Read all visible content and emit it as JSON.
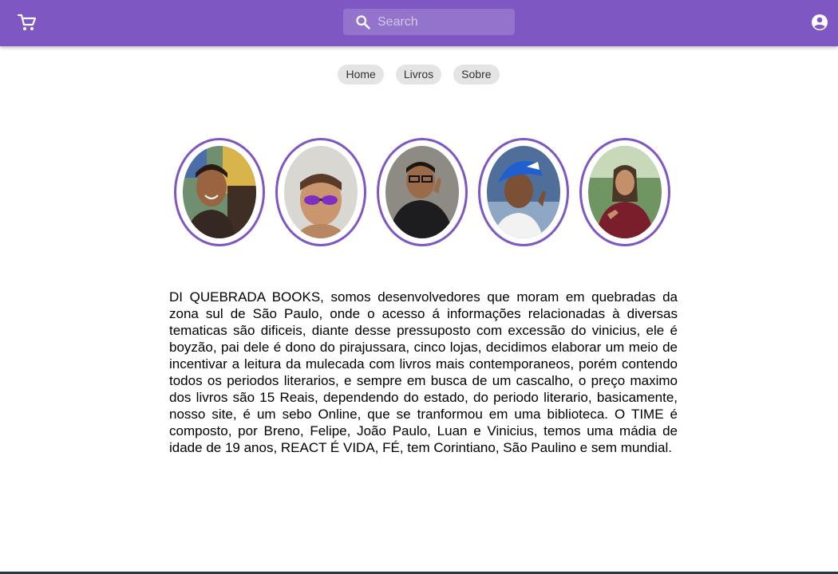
{
  "colors": {
    "accent": "#7e57c2",
    "chip_bg": "#e4e4e4"
  },
  "header": {
    "cart_icon": "shopping-cart-icon",
    "account_icon": "account-circle-icon",
    "search": {
      "icon": "search-icon",
      "placeholder": "Search",
      "value": ""
    }
  },
  "nav": {
    "items": [
      {
        "label": "Home"
      },
      {
        "label": "Livros"
      },
      {
        "label": "Sobre"
      }
    ]
  },
  "team": {
    "members": [
      {
        "photo": "member-photo"
      },
      {
        "photo": "member-photo"
      },
      {
        "photo": "member-photo"
      },
      {
        "photo": "member-photo"
      },
      {
        "photo": "member-photo"
      }
    ]
  },
  "about": {
    "text": "DI QUEBRADA BOOKS, somos desenvolvedores que moram em quebradas da zona sul de São Paulo, onde o acesso á informações relacionadas à diversas tematicas são dificeis, diante desse pressuposto com excessão do vinicius, ele é boyzão, pai dele é dono do pirajussara, cinco lojas, decidimos elaborar um meio de incentivar a leitura da mulecada com livros mais contemporaneos, porém contendo todos os periodos literarios, e sempre em busca de um cascalho, o preço maximo dos livros são 15 Reais, dependendo do estado, do periodo literario, basicamente, nosso site, é um sebo Online, que se tranformou em uma biblioteca. O TIME é composto, por Breno, Felipe, João Paulo, Luan e Vinicius, temos uma mádia de idade de 19 anos, REACT É VIDA, FÉ, tem Corintiano, São Paulino e sem mundial."
  }
}
